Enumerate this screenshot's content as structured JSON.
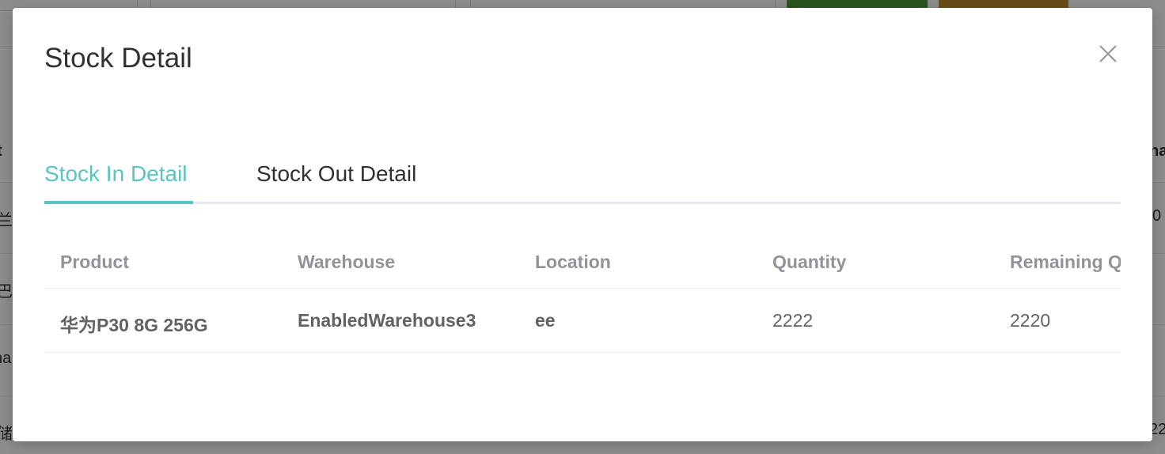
{
  "background": {
    "header_fragment": "t",
    "right_header_fragment": "na",
    "rows": [
      {
        "left": "兰",
        "right": "0"
      },
      {
        "left": "巴",
        "right": ""
      },
      {
        "left": "na",
        "right": ""
      },
      {
        "left": "储",
        "right": "22"
      }
    ],
    "colors": {
      "green_button": "#4a9a3a",
      "orange_button": "#c08a2e"
    }
  },
  "modal": {
    "title": "Stock Detail",
    "close_icon": "close-icon",
    "tabs": [
      {
        "label": "Stock In Detail",
        "active": true
      },
      {
        "label": "Stock Out Detail",
        "active": false
      }
    ],
    "table": {
      "columns": [
        "Product",
        "Warehouse",
        "Location",
        "Quantity",
        "Remaining Q"
      ],
      "rows": [
        {
          "product": "华为P30 8G 256G",
          "warehouse": "EnabledWarehouse3",
          "location": "ee",
          "quantity": "2222",
          "remaining": "2220"
        }
      ]
    },
    "colors": {
      "accent": "#5ac4c0",
      "title": "#303133",
      "header_text": "#909399",
      "cell_text": "#606266"
    }
  }
}
